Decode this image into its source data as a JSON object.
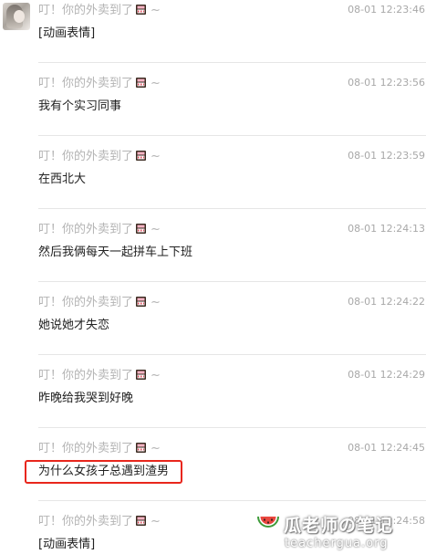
{
  "chat": {
    "messages": [
      {
        "sender": "叮！你的外卖到了",
        "sender_suffix": "~",
        "time": "08-01 12:23:46",
        "text": "[动画表情]"
      },
      {
        "sender": "叮！你的外卖到了",
        "sender_suffix": "~",
        "time": "08-01 12:23:56",
        "text": "我有个实习同事"
      },
      {
        "sender": "叮！你的外卖到了",
        "sender_suffix": "~",
        "time": "08-01 12:23:59",
        "text": "在西北大"
      },
      {
        "sender": "叮！你的外卖到了",
        "sender_suffix": "~",
        "time": "08-01 12:24:13",
        "text": "然后我俩每天一起拼车上下班"
      },
      {
        "sender": "叮！你的外卖到了",
        "sender_suffix": "~",
        "time": "08-01 12:24:22",
        "text": "她说她才失恋"
      },
      {
        "sender": "叮！你的外卖到了",
        "sender_suffix": "~",
        "time": "08-01 12:24:29",
        "text": "昨晚给我哭到好晚"
      },
      {
        "sender": "叮！你的外卖到了",
        "sender_suffix": "~",
        "time": "08-01 12:24:45",
        "text": "为什么女孩子总遇到渣男",
        "highlighted": true
      },
      {
        "sender": "叮！你的外卖到了",
        "sender_suffix": "~",
        "time": "08-01 12:24:58",
        "text": "[动画表情]"
      }
    ]
  },
  "icons": {
    "avatar": "user-avatar",
    "sender_emoji": "cake-emoji-icon",
    "watermark": "watermelon-icon"
  },
  "watermark": {
    "title": "瓜老师の笔记",
    "url": "teachergua.org"
  },
  "colors": {
    "highlight_border": "#e8261c",
    "sender_text": "#b4b4b4",
    "message_text": "#222222",
    "separator": "#e6e6e6"
  }
}
